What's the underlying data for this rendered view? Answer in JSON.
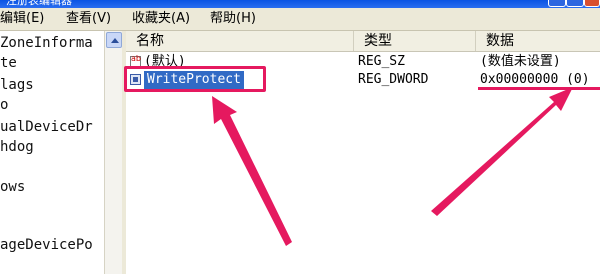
{
  "window": {
    "title": "注册表编辑器"
  },
  "menu": [
    {
      "label": "编辑(E)"
    },
    {
      "label": "查看(V)"
    },
    {
      "label": "收藏夹(A)"
    },
    {
      "label": "帮助(H)"
    }
  ],
  "tree": {
    "items": [
      {
        "label": "ZoneInforma"
      },
      {
        "label": "te"
      },
      {
        "label": "lags"
      },
      {
        "label": "o"
      },
      {
        "label": "ualDeviceDr"
      },
      {
        "label": "hdog"
      },
      {
        "label": "ows"
      },
      {
        "label": "ageDevicePo"
      }
    ]
  },
  "list": {
    "columns": {
      "name": "名称",
      "type": "类型",
      "data": "数据"
    },
    "rows": [
      {
        "icon": "string-value-icon",
        "name": "(默认)",
        "type": "REG_SZ",
        "data": "(数值未设置)"
      },
      {
        "icon": "dword-value-icon",
        "name": "WriteProtect",
        "type": "REG_DWORD",
        "data": "0x00000000 (0)"
      }
    ]
  },
  "annotation": {
    "color": "#e5195f"
  },
  "colors": {
    "titlebar": "#0a54e3",
    "selection": "#316ac5",
    "menubar": "#ece9d8"
  }
}
